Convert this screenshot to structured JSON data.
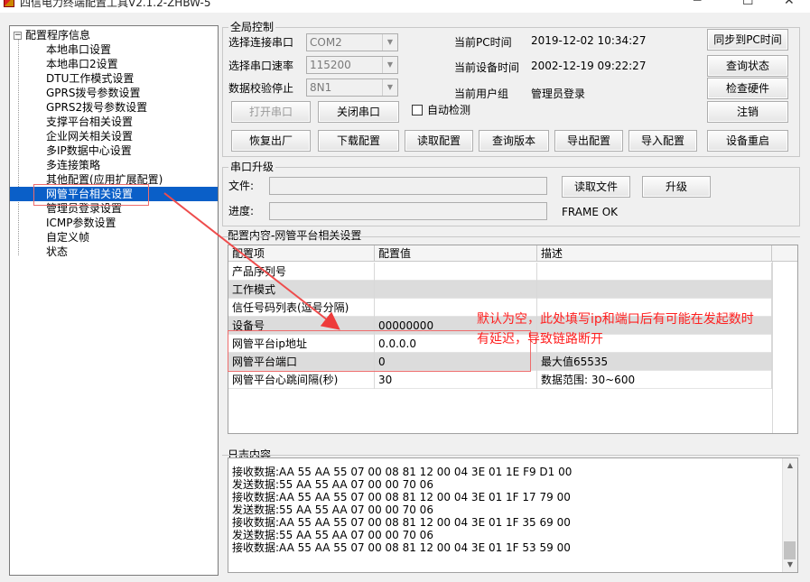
{
  "window": {
    "title": "四信电力终端配置工具V2.1.2-ZHBW-5"
  },
  "tree": {
    "root_label": "配置程序信息",
    "expander": "⊟",
    "items": [
      "本地串口设置",
      "本地串口2设置",
      "DTU工作模式设置",
      "GPRS拨号参数设置",
      "GPRS2拨号参数设置",
      "支撑平台相关设置",
      "企业网关相关设置",
      "多IP数据中心设置",
      "多连接策略",
      "其他配置(应用扩展配置)",
      "网管平台相关设置",
      "管理员登录设置",
      "ICMP参数设置",
      "自定义帧",
      "状态"
    ],
    "selected_index": 10
  },
  "global": {
    "legend": "全局控制",
    "port_label": "选择连接串口",
    "port_value": "COM2",
    "baud_label": "选择串口速率",
    "baud_value": "115200",
    "parity_label": "数据校验停止",
    "parity_value": "8N1",
    "pc_time_label": "当前PC时间",
    "pc_time_value": "2019-12-02 10:34:27",
    "dev_time_label": "当前设备时间",
    "dev_time_value": "2002-12-19 09:22:27",
    "user_label": "当前用户组",
    "user_value": "管理员登录",
    "auto_detect_label": "自动检测",
    "buttons": {
      "open_port": "打开串口",
      "close_port": "关闭串口",
      "sync_pc_time": "同步到PC时间",
      "query_status": "查询状态",
      "check_hw": "检查硬件",
      "logout": "注销",
      "factory_reset": "恢复出厂",
      "download_cfg": "下载配置",
      "read_cfg": "读取配置",
      "query_version": "查询版本",
      "export_cfg": "导出配置",
      "import_cfg": "导入配置",
      "reboot": "设备重启"
    }
  },
  "upgrade": {
    "legend": "串口升级",
    "file_label": "文件:",
    "progress_label": "进度:",
    "read_file": "读取文件",
    "upgrade": "升级",
    "status": "FRAME OK"
  },
  "config": {
    "legend": "配置内容-网管平台相关设置",
    "columns": [
      "配置项",
      "配置值",
      "描述"
    ],
    "rows": [
      {
        "item": "产品序列号",
        "value": "",
        "desc": ""
      },
      {
        "item": "工作模式",
        "value": "",
        "desc": ""
      },
      {
        "item": "信任号码列表(逗号分隔)",
        "value": "",
        "desc": ""
      },
      {
        "item": "设备号",
        "value": "00000000",
        "desc": ""
      },
      {
        "item": "网管平台ip地址",
        "value": "0.0.0.0",
        "desc": ""
      },
      {
        "item": "网管平台端口",
        "value": "0",
        "desc": "最大值65535"
      },
      {
        "item": "网管平台心跳间隔(秒)",
        "value": "30",
        "desc": "数据范围: 30~600"
      }
    ]
  },
  "log": {
    "legend": "日志内容",
    "lines": [
      "接收数据:AA 55 AA 55 07 00 08 81 12 00 04 3E 01 1E F9 D1 00",
      "发送数据:55 AA 55 AA 07 00 00 70 06",
      "接收数据:AA 55 AA 55 07 00 08 81 12 00 04 3E 01 1F 17 79 00",
      "发送数据:55 AA 55 AA 07 00 00 70 06",
      "接收数据:AA 55 AA 55 07 00 08 81 12 00 04 3E 01 1F 35 69 00",
      "发送数据:55 AA 55 AA 07 00 00 70 06",
      "接收数据:AA 55 AA 55 07 00 08 81 12 00 04 3E 01 1F 53 59 00"
    ]
  },
  "annotation": {
    "text_line1": "默认为空，此处填写ip和端口后有可能在发起数时",
    "text_line2": "有延迟，导致链路断开",
    "color": "#ff2020"
  }
}
